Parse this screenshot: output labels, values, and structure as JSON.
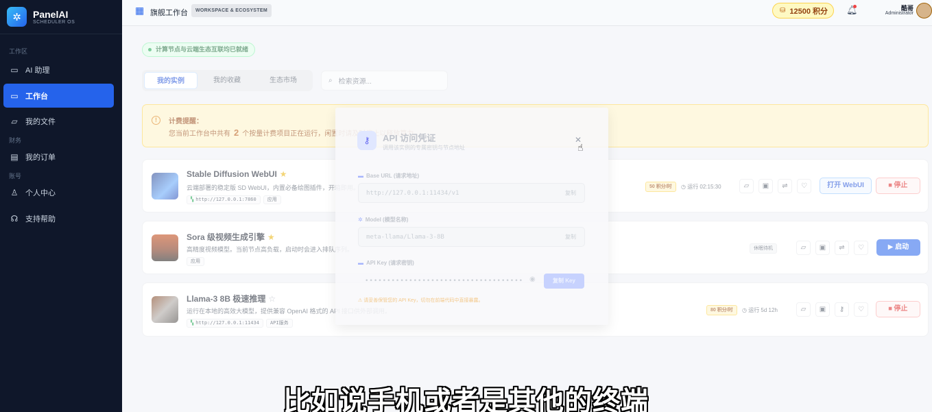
{
  "brand": {
    "name": "PanelAI",
    "sub": "SCHEDULER OS"
  },
  "sidebar": {
    "sections": [
      "工作区",
      "财务",
      "账号"
    ],
    "items": [
      {
        "label": "AI 助理",
        "icon": "chat-icon"
      },
      {
        "label": "工作台",
        "icon": "monitor-icon",
        "active": true
      },
      {
        "label": "我的文件",
        "icon": "folder-icon"
      },
      {
        "label": "我的订单",
        "icon": "receipt-icon"
      },
      {
        "label": "个人中心",
        "icon": "user-icon"
      },
      {
        "label": "支持帮助",
        "icon": "headset-icon"
      }
    ]
  },
  "header": {
    "title": "旗舰工作台",
    "tag": "WORKSPACE & ECOSYSTEM",
    "credits": "12500 积分",
    "user_name": "酷哥",
    "user_role": "Administrator"
  },
  "status": "计算节点与云端生态互联均已就绪",
  "tabs": [
    "我的实例",
    "我的收藏",
    "生态市场"
  ],
  "search": {
    "placeholder": "检索资源..."
  },
  "notice": {
    "title": "计费提醒：",
    "body_pre": "您当前工作台中共有",
    "count": "2",
    "body_post": "个按量计费项目正在运行，闲置时请及时停止以释放算力。"
  },
  "instances": [
    {
      "title": "Stable Diffusion WebUI",
      "star": "★",
      "desc": "云端部署的稳定版 SD WebUI，内置必备绘图插件，开箱即用。支持多种引擎及多模型接入。",
      "tags": [
        "http://127.0.0.1:7860",
        "应用"
      ],
      "price": "50 积分/时",
      "runtime": "◷ 运行 02:15:30",
      "primary_label": "打开 WebUI",
      "stop_label": "⏹ 停止"
    },
    {
      "title": "Sora 级视频生成引擎",
      "star": "★",
      "desc": "高精度视频模型。当前节点高负载，启动时会进入排队序列。",
      "tags": [
        "应用"
      ],
      "sleep": "休眠待机",
      "start_label": "▶ 启动"
    },
    {
      "title": "Llama-3 8B 极速推理",
      "star": "☆",
      "desc": "运行在本地的高效大模型，提供兼容 OpenAI 格式的 API 接口供外部调用。",
      "tags": [
        "http://127.0.0.1:11434",
        "API服务"
      ],
      "price": "80 积分/时",
      "runtime": "◷ 运行 5d 12h",
      "stop_label": "⏹ 停止"
    }
  ],
  "modal": {
    "title": "API 访问凭证",
    "subtitle": "调用该实例的专属密钥与节点地址",
    "base_url_label": "Base URL (请求地址)",
    "base_url": "http://127.0.0.1:11434/v1",
    "model_label": "Model (模型名称)",
    "model": "meta-llama/Llama-3-8B",
    "key_label": "API Key (请求密钥)",
    "key_masked": "••••••••••••••••••••••••••••••••••••",
    "copy": "复制",
    "copy_key": "复制 Key",
    "warning": "⚠ 请妥善保管您的 API Key，切勿在前端代码中直接暴露。"
  },
  "subtitle": "比如说手机或者是其他的终端"
}
